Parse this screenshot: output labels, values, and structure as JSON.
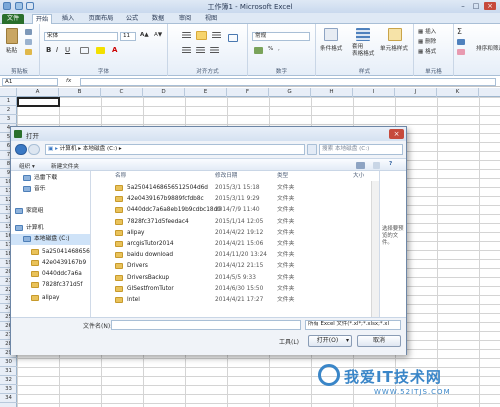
{
  "excel": {
    "window_title": "工作簿1 - Microsoft Excel",
    "tabs": [
      "文件",
      "开始",
      "插入",
      "页面布局",
      "公式",
      "数据",
      "审阅",
      "视图"
    ],
    "ribbon": {
      "paste_label": "粘贴",
      "clipboard_label": "剪贴板",
      "font_name": "宋体",
      "font_size": "11",
      "font_label": "字体",
      "align_label": "对齐方式",
      "number_format": "常规",
      "number_label": "数字",
      "cond_format_label": "条件格式",
      "table_format_label": "套用\n表格格式",
      "cell_style_label": "单元格样式",
      "style_label": "样式",
      "insert_label": "插入",
      "delete_label": "删除",
      "format_label": "格式",
      "cells_label": "单元格",
      "sort_label": "排序和筛选"
    },
    "name_box": "A1",
    "formula_icon": "fx",
    "columns": [
      "A",
      "B",
      "C",
      "D",
      "E",
      "F",
      "G",
      "H",
      "I",
      "J",
      "K"
    ],
    "rows": [
      "1",
      "2",
      "3",
      "4",
      "5",
      "6",
      "7",
      "8",
      "9",
      "10",
      "11",
      "12",
      "13",
      "14",
      "15",
      "16",
      "17",
      "18",
      "19",
      "20",
      "21",
      "22",
      "23",
      "24",
      "25",
      "26",
      "27",
      "28",
      "29",
      "30",
      "31",
      "32",
      "33",
      "34"
    ]
  },
  "dialog": {
    "title": "打开",
    "address_path": [
      "计算机",
      "本地磁盘 (C:)"
    ],
    "search_placeholder": "搜索 本地磁盘 (C:)",
    "toolbar": {
      "organize": "组织 ▾",
      "new_folder": "新建文件夹"
    },
    "nav": [
      {
        "label": "迅雷下载",
        "indent": 1,
        "icon": "download-icon"
      },
      {
        "label": "音乐",
        "indent": 1,
        "icon": "music-icon"
      },
      {
        "label": "家庭组",
        "indent": 0,
        "icon": "homegroup-icon"
      },
      {
        "label": "计算机",
        "indent": 0,
        "icon": "computer-icon"
      },
      {
        "label": "本地磁盘 (C:)",
        "indent": 1,
        "icon": "drive-icon"
      },
      {
        "label": "5a25041468656",
        "indent": 2,
        "icon": "folder-icon"
      },
      {
        "label": "42e0439167b9",
        "indent": 2,
        "icon": "folder-icon"
      },
      {
        "label": "0440ddc7a6a",
        "indent": 2,
        "icon": "folder-icon"
      },
      {
        "label": "7828fc371d5f",
        "indent": 2,
        "icon": "folder-icon"
      },
      {
        "label": "alipay",
        "indent": 2,
        "icon": "folder-icon"
      }
    ],
    "columns": {
      "name": "名称",
      "date": "修改日期",
      "type": "类型",
      "size": "大小"
    },
    "files": [
      {
        "name": "5a25041468656512504d6d",
        "date": "2015/3/1 15:18",
        "type": "文件夹"
      },
      {
        "name": "42e0439167b9889fcfdb8c",
        "date": "2015/3/11 9:29",
        "type": "文件夹"
      },
      {
        "name": "0440ddc7a6a8eb19b9cdbc18d0",
        "date": "2014/7/9 11:40",
        "type": "文件夹"
      },
      {
        "name": "7828fc371d5feedac4",
        "date": "2015/1/14 12:05",
        "type": "文件夹"
      },
      {
        "name": "alipay",
        "date": "2014/4/22 19:12",
        "type": "文件夹"
      },
      {
        "name": "arcgisTutor2014",
        "date": "2014/4/21 15:06",
        "type": "文件夹"
      },
      {
        "name": "baidu download",
        "date": "2014/11/20 13:24",
        "type": "文件夹"
      },
      {
        "name": "Drivers",
        "date": "2014/4/12 21:15",
        "type": "文件夹"
      },
      {
        "name": "DriversBackup",
        "date": "2014/5/5 9:33",
        "type": "文件夹"
      },
      {
        "name": "GISestfromTutor",
        "date": "2014/6/30 15:50",
        "type": "文件夹"
      },
      {
        "name": "Intel",
        "date": "2014/4/21 17:27",
        "type": "文件夹"
      }
    ],
    "preview_text": "选择要预览的文件。",
    "filename_label": "文件名(N):",
    "filename_value": "",
    "filetype_value": "所有 Excel 文件(*.xl*;*.xlsx;*.xl",
    "tools_label": "工具(L)",
    "open_label": "打开(O)",
    "cancel_label": "取消"
  },
  "watermark": {
    "text": "我爱IT技术网",
    "url": "WWW.52ITJS.COM"
  }
}
